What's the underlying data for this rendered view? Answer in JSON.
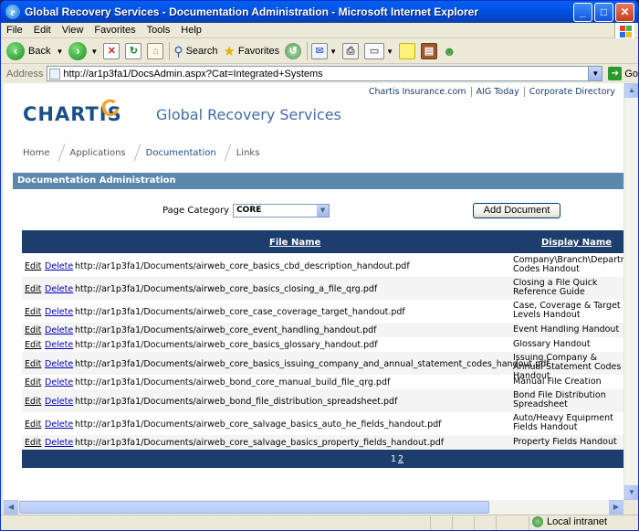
{
  "window": {
    "title": "Global Recovery Services - Documentation Administration - Microsoft Internet Explorer"
  },
  "menu": [
    "File",
    "Edit",
    "View",
    "Favorites",
    "Tools",
    "Help"
  ],
  "toolbar": {
    "back": "Back",
    "search": "Search",
    "favorites": "Favorites"
  },
  "address": {
    "label": "Address",
    "url": "http://ar1p3fa1/DocsAdmin.aspx?Cat=Integrated+Systems",
    "go": "Go"
  },
  "status": {
    "zone": "Local intranet"
  },
  "page": {
    "top_links": [
      "Chartis Insurance.com",
      "AIG Today",
      "Corporate Directory"
    ],
    "logo_text": "CHARTIS",
    "site_title": "Global Recovery Services",
    "nav": [
      "Home",
      "Applications",
      "Documentation",
      "Links"
    ],
    "section_title": "Documentation Administration",
    "category_label": "Page Category",
    "category_value": "CORE",
    "add_button": "Add Document",
    "table": {
      "headers": {
        "file": "File Name",
        "display": "Display Name"
      },
      "edit_label": "Edit",
      "delete_label": "Delete",
      "rows": [
        {
          "url": "http://ar1p3fa1/Documents/airweb_core_basics_cbd_description_handout.pdf",
          "display": "Company\\Branch\\Department Codes Handout"
        },
        {
          "url": "http://ar1p3fa1/Documents/airweb_core_basics_closing_a_file_qrg.pdf",
          "display": "Closing a File Quick Reference Guide"
        },
        {
          "url": "http://ar1p3fa1/Documents/airweb_core_case_coverage_target_handout.pdf",
          "display": "Case, Coverage & Target Levels Handout"
        },
        {
          "url": "http://ar1p3fa1/Documents/airweb_core_event_handling_handout.pdf",
          "display": "Event Handling Handout"
        },
        {
          "url": "http://ar1p3fa1/Documents/airweb_core_basics_glossary_handout.pdf",
          "display": "Glossary Handout"
        },
        {
          "url": "http://ar1p3fa1/Documents/airweb_core_basics_issuing_company_and_annual_statement_codes_handout.pdf",
          "display": "Issuing Company & Annual Statement Codes Handout"
        },
        {
          "url": "http://ar1p3fa1/Documents/airweb_bond_core_manual_build_file_qrg.pdf",
          "display": "Manual File Creation"
        },
        {
          "url": "http://ar1p3fa1/Documents/airweb_bond_file_distribution_spreadsheet.pdf",
          "display": "Bond File Distribution Spreadsheet"
        },
        {
          "url": "http://ar1p3fa1/Documents/airweb_core_salvage_basics_auto_he_fields_handout.pdf",
          "display": "Auto/Heavy Equipment Fields Handout"
        },
        {
          "url": "http://ar1p3fa1/Documents/airweb_core_salvage_basics_property_fields_handout.pdf",
          "display": "Property Fields Handout"
        }
      ],
      "pager": [
        "1",
        "2"
      ]
    }
  }
}
